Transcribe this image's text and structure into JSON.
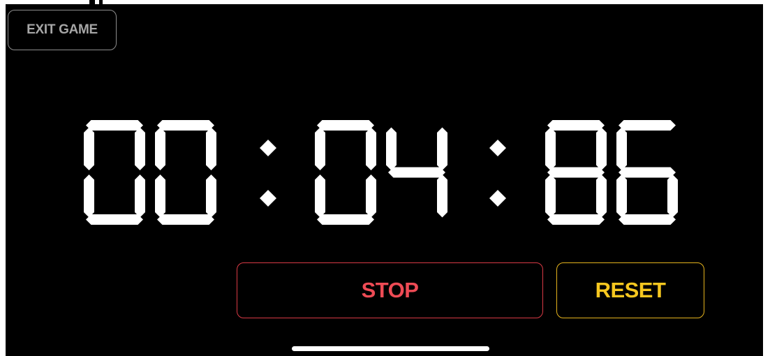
{
  "header": {
    "exit_label": "EXIT GAME"
  },
  "timer": {
    "display": "00:04:86",
    "digits": [
      "0",
      "0",
      "0",
      "4",
      "8",
      "6"
    ],
    "color": "#ffffff"
  },
  "controls": {
    "stop_label": "STOP",
    "reset_label": "RESET",
    "stop_color": "#ee4b55",
    "reset_color": "#f6c71f"
  },
  "background": "#000000"
}
